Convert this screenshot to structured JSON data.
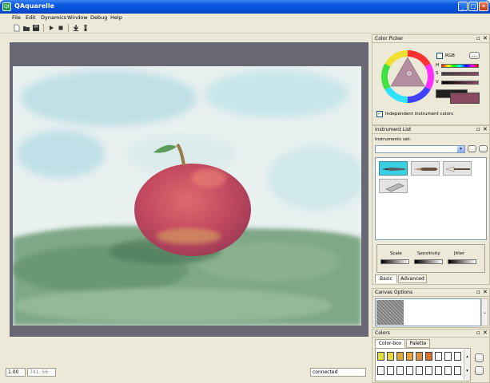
{
  "window": {
    "title": "QAquarelle",
    "app_icon_text": "Qt",
    "minimize_glyph": "_",
    "maximize_glyph": "□",
    "close_glyph": "✕"
  },
  "menu": [
    "File",
    "Edit",
    "Dynamics",
    "Window",
    "Debug",
    "Help"
  ],
  "toolbar": {
    "icons": [
      "new-document-icon",
      "open-folder-icon",
      "save-icon",
      "play-icon",
      "stop-icon",
      "download-icon",
      "brush-icon"
    ]
  },
  "color_picker": {
    "title": "Color Picker",
    "rgb_label": "RGB",
    "more_label": "...",
    "h_label": "H",
    "s_label": "S",
    "v_label": "V",
    "independent_label": "Independent instrument colors",
    "independent_checked": true,
    "rgb_checked": false,
    "current_color": "#8a4a62"
  },
  "instrument_list": {
    "title": "Instrument List",
    "set_label": "Instruments set:",
    "tools": [
      "round-brush-icon",
      "flat-brush-icon",
      "fan-brush-icon",
      "eraser-icon"
    ],
    "selected_tool": "round-brush-icon",
    "scale_label": "Scale",
    "sensitivity_label": "Sensitivity",
    "jitter_label": "Jitter",
    "tabs": [
      "Basic",
      "Advanced"
    ],
    "active_tab": "Basic"
  },
  "canvas_options": {
    "title": "Canvas Options"
  },
  "colors_panel": {
    "title": "Colors",
    "tabs": [
      "Color-box",
      "Palette"
    ],
    "active_tab": "Color-box",
    "swatches_row1": [
      "#e0e040",
      "#e8d848",
      "#e0a838",
      "#e8a040",
      "#d89048",
      "#d87030",
      "#ffffff",
      "#ffffff",
      "#ffffff"
    ],
    "swatches_row2": [
      "#ffffff",
      "#ffffff",
      "#ffffff",
      "#ffffff",
      "#ffffff",
      "#ffffff",
      "#ffffff",
      "#ffffff",
      "#ffffff"
    ]
  },
  "statusbar": {
    "zoom": "1.00",
    "coords": "741, 56",
    "status": "connected"
  },
  "colors": {
    "title_blue": "#0a58df",
    "selection_cyan": "#38d0e0"
  }
}
